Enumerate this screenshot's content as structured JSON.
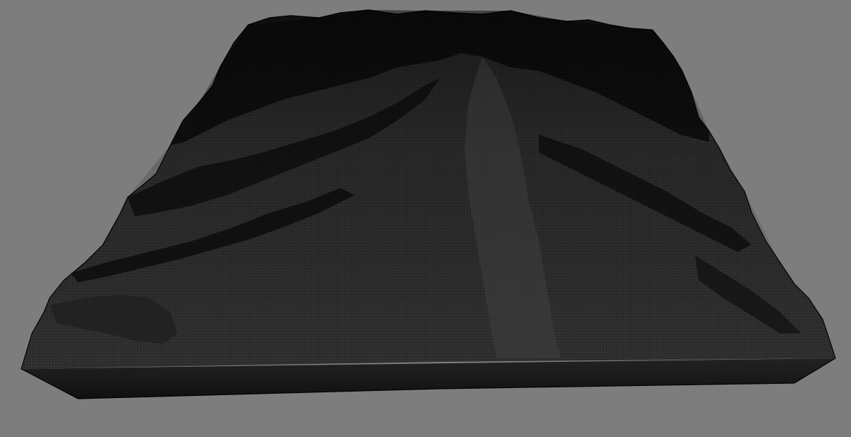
{
  "viewport": {
    "background_color": "#7d7d7d"
  },
  "terrain": {
    "render_mode": "wireframe",
    "mesh_color": "#2e2e2e",
    "wire_color": "#4a4a4a",
    "shadow_color": "#050505",
    "base_color": "#1a1a1a"
  }
}
